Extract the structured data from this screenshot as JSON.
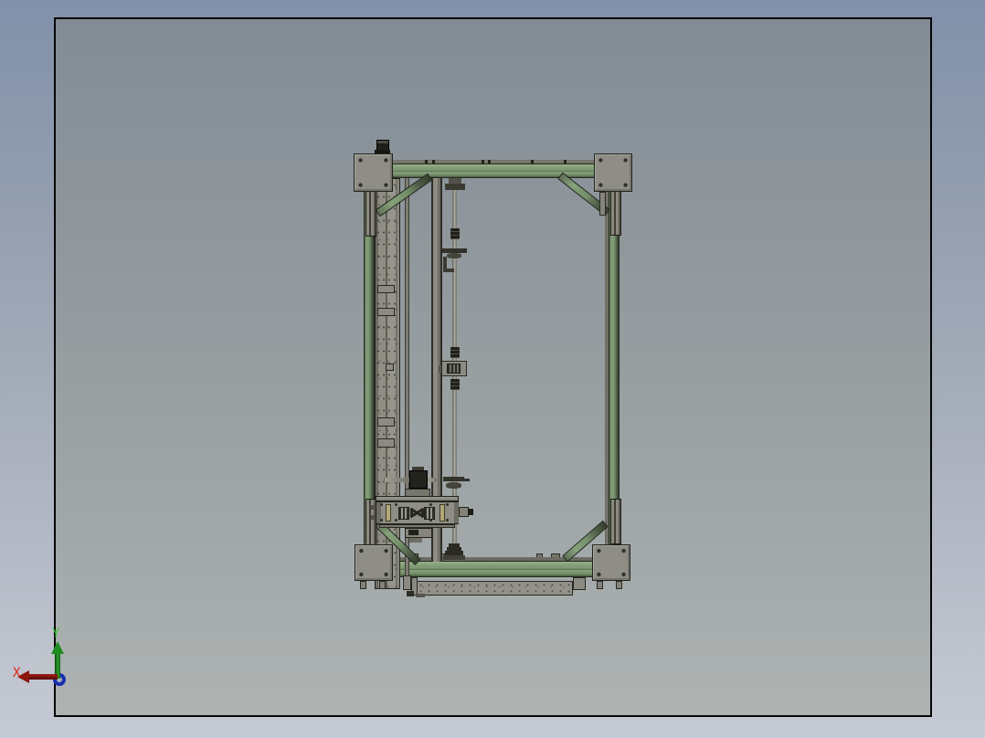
{
  "app": {
    "description": "CAD assembly viewer, front view of a 3D printer frame"
  },
  "canvas": {
    "bg_top": "#8191AA",
    "bg_bottom": "#C6CAD5"
  },
  "viewport": {
    "bg_top": "#838C95",
    "bg_bottom": "#AEB3B2",
    "border_color": "#000000"
  },
  "triad": {
    "x_label": "X",
    "y_label": "Y",
    "x_axis_color": "#8C150D",
    "y_axis_color": "#1F8C1F",
    "z_ring_color": "#1A2FB0",
    "x_label_color": "#E02818",
    "y_label_color": "#2ECB2E",
    "fan_color": "#BFC4CB"
  },
  "model": {
    "name": "3D printer frame assembly",
    "palette": {
      "extrusion_green": "#7F9B74",
      "plate_gray": "#8E8E86",
      "rail_gray": "#8B8B81",
      "outline": "#23231D",
      "lead_screw_gray": "#A9A99F",
      "spring_tan": "#B3A87A",
      "motor_black": "#23231D"
    },
    "parts": [
      "corner-plate-top-left",
      "corner-plate-top-right",
      "corner-plate-bottom-left",
      "corner-plate-bottom-right",
      "top-beam",
      "bottom-beam",
      "left-column",
      "right-column",
      "z-tower-rail",
      "guide-rod",
      "center-column",
      "lead-screw",
      "shaft-coupler",
      "lead-screw-nut-block",
      "z-motor",
      "x-carriage",
      "carriage-springs",
      "bed-platform",
      "diagonal-brace-top-left",
      "diagonal-brace-top-right",
      "diagonal-brace-bottom-left",
      "diagonal-brace-bottom-right",
      "top-stepper-cap"
    ]
  }
}
